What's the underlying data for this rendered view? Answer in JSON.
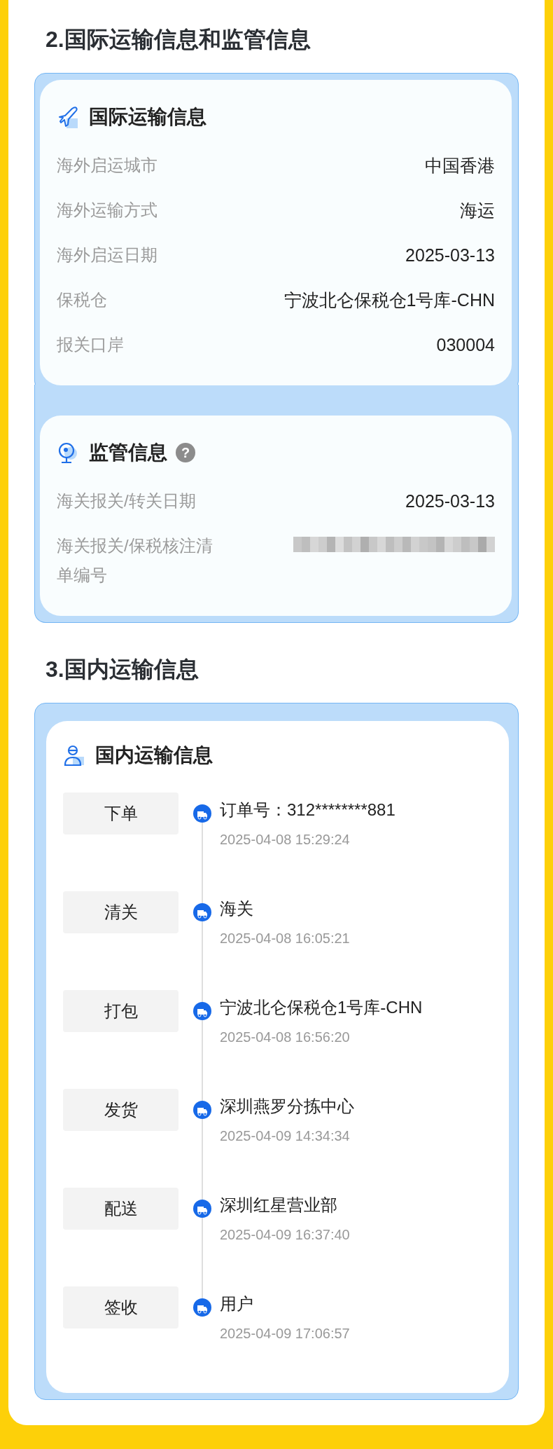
{
  "sections": [
    {
      "heading": "2.国际运输信息和监管信息",
      "cards": [
        {
          "kind": "plane",
          "title": "国际运输信息",
          "rows": [
            {
              "kind": "text",
              "label": "海外启运城市",
              "value": "中国香港"
            },
            {
              "kind": "text",
              "label": "海外运输方式",
              "value": "海运"
            },
            {
              "kind": "text",
              "label": "海外启运日期",
              "value": "2025-03-13"
            },
            {
              "kind": "text",
              "label": "保税仓",
              "value": "宁波北仑保税仓1号库-CHN"
            },
            {
              "kind": "text",
              "label": "报关口岸",
              "value": "030004"
            }
          ]
        },
        {
          "kind": "webcam",
          "title": "监管信息",
          "help_text": "?",
          "rows": [
            {
              "kind": "text",
              "label": "海关报关/转关日期",
              "value": "2025-03-13"
            },
            {
              "kind": "redacted",
              "label": "海关报关/保税核注清单编号"
            }
          ]
        }
      ]
    },
    {
      "heading": "3.国内运输信息",
      "cards": [
        {
          "kind": "person",
          "title": "国内运输信息",
          "timeline": [
            {
              "step": "下单",
              "place": "订单号：312********881",
              "time": "2025-04-08 15:29:24"
            },
            {
              "step": "清关",
              "place": "海关",
              "time": "2025-04-08 16:05:21"
            },
            {
              "step": "打包",
              "place": "宁波北仑保税仓1号库-CHN",
              "time": "2025-04-08 16:56:20"
            },
            {
              "step": "发货",
              "place": "深圳燕罗分拣中心",
              "time": "2025-04-09 14:34:34"
            },
            {
              "step": "配送",
              "place": "深圳红星营业部",
              "time": "2025-04-09 16:37:40"
            },
            {
              "step": "签收",
              "place": "用户",
              "time": "2025-04-09 17:06:57"
            }
          ]
        }
      ]
    }
  ]
}
